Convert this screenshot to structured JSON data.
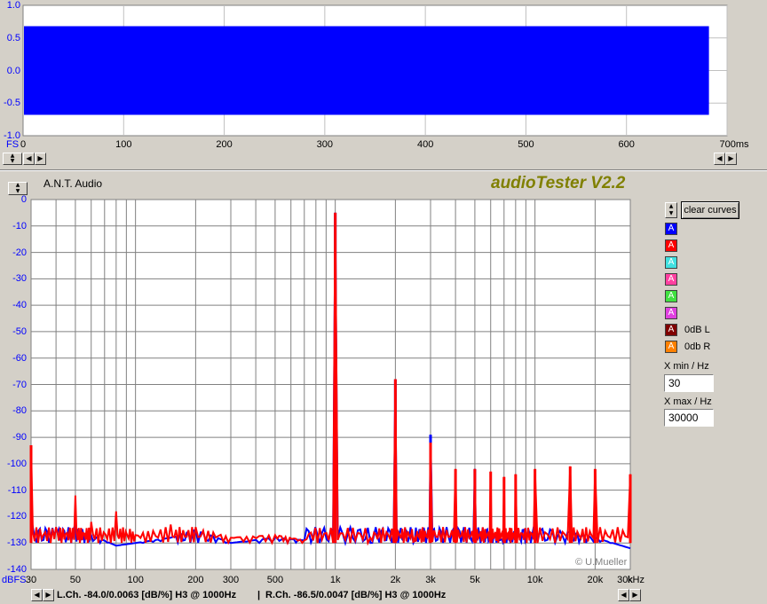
{
  "waveform": {
    "y_ticks": [
      "1.0",
      "0.5",
      "0.0",
      "-0.5",
      "-1.0"
    ],
    "y_tick_values": [
      1.0,
      0.5,
      0.0,
      -0.5,
      -1.0
    ],
    "extra_y_ticks": [
      "0.9",
      "0.8",
      "0.7",
      "0.6",
      "0.4",
      "0.3",
      "0.2",
      "0.1",
      "-0.1",
      "-0.2",
      "-0.3",
      "-0.4",
      "-0.6",
      "-0.7",
      "-0.8",
      "-0.9"
    ],
    "x_unit_left": "FS",
    "x_ticks": [
      "0",
      "100",
      "200",
      "300",
      "400",
      "500",
      "600",
      "700ms"
    ],
    "x_tick_values": [
      0,
      100,
      200,
      300,
      400,
      500,
      600,
      700
    ],
    "signal_color": "#0000ff",
    "signal_extent_ms": [
      0,
      682
    ],
    "signal_amplitude": 0.68
  },
  "spectrum": {
    "author_label": "A.N.T. Audio",
    "app_title": "audioTester V2.2",
    "copyright": "© U.Mueller",
    "y_unit": "dBFS",
    "x_unit": "kHz",
    "y_ticks": [
      "0",
      "-10",
      "-20",
      "-30",
      "-40",
      "-50",
      "-60",
      "-70",
      "-80",
      "-90",
      "-100",
      "-110",
      "-120",
      "-130",
      "-140"
    ],
    "x_ticks": [
      "30",
      "50",
      "100",
      "200",
      "300",
      "500",
      "1k",
      "2k",
      "3k",
      "5k",
      "10k",
      "20k",
      "30k"
    ],
    "x_tick_values": [
      30,
      50,
      100,
      200,
      300,
      500,
      1000,
      2000,
      3000,
      5000,
      10000,
      20000,
      30000
    ],
    "status_left": "L.Ch. -84.0/0.0063 [dB/%] H3 @ 1000Hz",
    "status_right": "R.Ch. -86.5/0.0047 [dB/%] H3 @ 1000Hz"
  },
  "chart_data": {
    "type": "line",
    "title": "audioTester V2.2",
    "xlabel": "kHz",
    "ylabel": "dBFS",
    "xscale": "log",
    "xlim": [
      30,
      30000
    ],
    "ylim": [
      -140,
      0
    ],
    "grid": true,
    "series": [
      {
        "name": "L.Ch.",
        "color": "#0000ff",
        "x": [
          30,
          40,
          50,
          60,
          80,
          100,
          150,
          200,
          300,
          500,
          700,
          1000,
          1500,
          2000,
          2500,
          3000,
          4000,
          5000,
          6000,
          7000,
          8000,
          10000,
          15000,
          20000,
          30000
        ],
        "y": [
          -120,
          -125,
          -123,
          -127,
          -131,
          -130,
          -128,
          -125,
          -130,
          -128,
          -129,
          -5,
          -130,
          -68,
          -129,
          -89,
          -129,
          -102,
          -127,
          -129,
          -125,
          -124,
          -126,
          -128,
          -132
        ]
      },
      {
        "name": "R.Ch.",
        "color": "#ff0000",
        "x": [
          30,
          40,
          50,
          60,
          80,
          100,
          150,
          200,
          300,
          500,
          700,
          1000,
          1500,
          2000,
          2500,
          3000,
          4000,
          5000,
          6000,
          7000,
          8000,
          10000,
          15000,
          20000,
          30000
        ],
        "y": [
          -93,
          -124,
          -112,
          -122,
          -118,
          -127,
          -123,
          -124,
          -128,
          -127,
          -129,
          -5,
          -128,
          -68,
          -128,
          -92,
          -102,
          -102,
          -103,
          -105,
          -104,
          -102,
          -101,
          -102,
          -104
        ]
      }
    ]
  },
  "legend": {
    "clear_label": "clear curves",
    "swatches": [
      {
        "color": "#0000ff",
        "glyph": "A",
        "label": ""
      },
      {
        "color": "#ff0000",
        "glyph": "A",
        "label": ""
      },
      {
        "color": "#40e0e0",
        "glyph": "A",
        "label": ""
      },
      {
        "color": "#ff40a0",
        "glyph": "A",
        "label": ""
      },
      {
        "color": "#40e040",
        "glyph": "A",
        "label": ""
      },
      {
        "color": "#e040e0",
        "glyph": "A",
        "label": ""
      },
      {
        "color": "#800000",
        "glyph": "A",
        "label": "0dB L"
      },
      {
        "color": "#ff8000",
        "glyph": "A",
        "label": "0db R"
      }
    ],
    "xmin_label": "X min / Hz",
    "xmin_value": "30",
    "xmax_label": "X max / Hz",
    "xmax_value": "30000"
  }
}
